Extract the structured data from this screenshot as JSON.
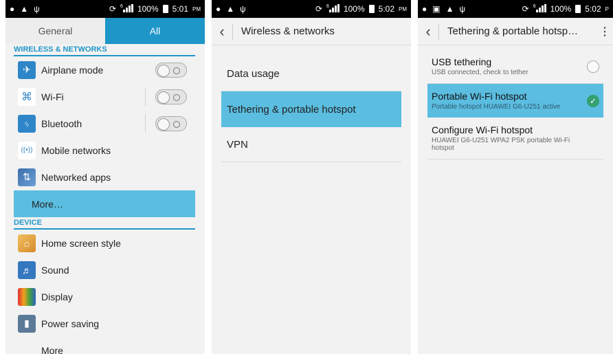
{
  "status_bars": [
    {
      "icons": [
        "location-icon",
        "cat-icon",
        "usb-icon"
      ],
      "time": "5:01",
      "ampm": "PM",
      "battery": "100%"
    },
    {
      "icons": [
        "location-icon",
        "cat-icon",
        "usb-icon"
      ],
      "time": "5:02",
      "ampm": "PM",
      "battery": "100%"
    },
    {
      "icons": [
        "location-icon",
        "tv-icon",
        "cat-icon",
        "usb-icon"
      ],
      "time": "5:02",
      "ampm": "P",
      "battery": "100%"
    }
  ],
  "signal_label": "6",
  "settings": {
    "tabs": [
      "General",
      "All"
    ],
    "active_tab": "All",
    "sections": {
      "wireless": "WIRELESS & NETWORKS",
      "device": "DEVICE"
    },
    "wireless_items": [
      {
        "label": "Airplane mode",
        "icon": "airplane-icon",
        "toggle": "off"
      },
      {
        "label": "Wi-Fi",
        "icon": "wifi-icon",
        "toggle": "off"
      },
      {
        "label": "Bluetooth",
        "icon": "bluetooth-icon",
        "toggle": "off"
      },
      {
        "label": "Mobile networks",
        "icon": "mobile-network-icon"
      },
      {
        "label": "Networked apps",
        "icon": "networked-apps-icon"
      },
      {
        "label": "More…",
        "selected": true
      }
    ],
    "device_items": [
      {
        "label": "Home screen style",
        "icon": "home-icon"
      },
      {
        "label": "Sound",
        "icon": "sound-icon"
      },
      {
        "label": "Display",
        "icon": "display-icon"
      },
      {
        "label": "Power saving",
        "icon": "battery-icon"
      },
      {
        "label": "More"
      }
    ]
  },
  "wireless_screen": {
    "title": "Wireless & networks",
    "items": [
      "Data usage",
      "Tethering & portable hotspot",
      "VPN"
    ],
    "selected": "Tethering & portable hotspot"
  },
  "tethering_screen": {
    "title": "Tethering & portable hotsp…",
    "prefs": [
      {
        "title": "USB tethering",
        "summary": "USB connected, check to tether",
        "checked": false
      },
      {
        "title": "Portable Wi-Fi hotspot",
        "summary": "Portable hotspot HUAWEI G6-U251 active",
        "checked": true
      },
      {
        "title": "Configure Wi-Fi hotspot",
        "summary": "HUAWEI G6-U251 WPA2 PSK portable Wi-Fi hotspot"
      }
    ]
  },
  "colors": {
    "accent": "#1e96c8",
    "selection": "#5bbde0",
    "check": "#35a070"
  }
}
